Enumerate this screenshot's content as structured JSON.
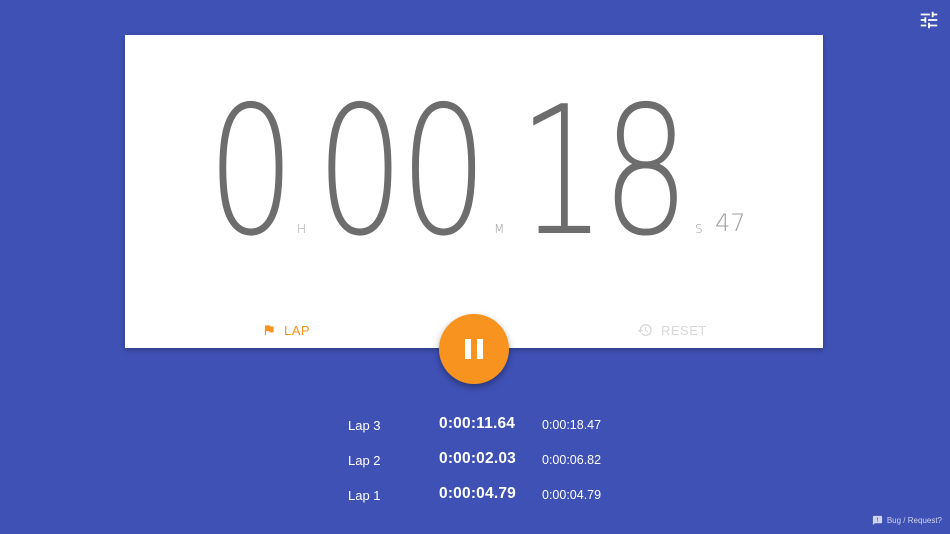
{
  "timer": {
    "hours": "0",
    "hours_unit": "H",
    "minutes": "00",
    "minutes_unit": "M",
    "seconds": "18",
    "seconds_unit": "S",
    "centiseconds": "47"
  },
  "controls": {
    "lap_label": "LAP",
    "reset_label": "RESET",
    "play_pause_state": "pause"
  },
  "laps": [
    {
      "name": "Lap 3",
      "split": "0:00:11.64",
      "total": "0:00:18.47"
    },
    {
      "name": "Lap 2",
      "split": "0:00:02.03",
      "total": "0:00:06.82"
    },
    {
      "name": "Lap 1",
      "split": "0:00:04.79",
      "total": "0:00:04.79"
    }
  ],
  "footer": {
    "feedback_label": "Bug / Request?"
  },
  "icons": {
    "settings": "tune-icon",
    "lap": "flag-icon",
    "reset": "history-icon",
    "pause": "pause-icon",
    "feedback": "feedback-icon"
  },
  "colors": {
    "background": "#3f51b5",
    "card": "#ffffff",
    "accent": "#f7931e",
    "digits": "#6d6d6d",
    "disabled": "#d8d8d8"
  }
}
